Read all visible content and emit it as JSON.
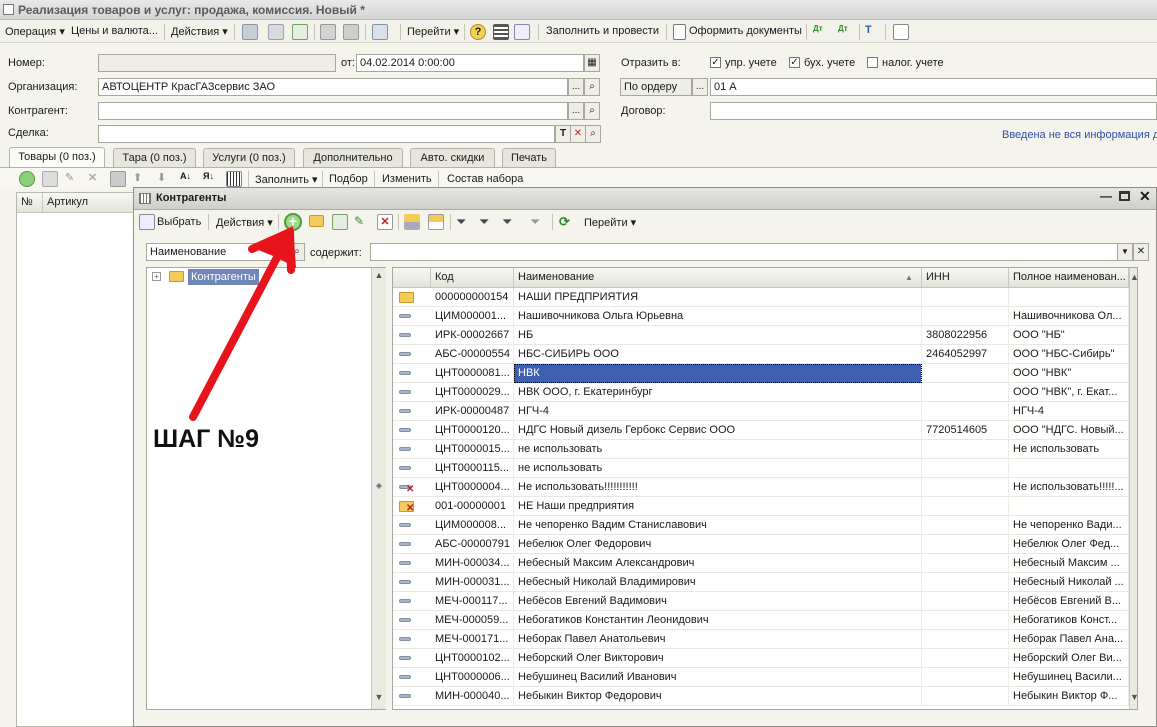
{
  "window": {
    "title": "Реализация товаров и услуг: продажа, комиссия. Новый *"
  },
  "menu": {
    "operation": "Операция ▾",
    "prices": "Цены и валюта...",
    "actions": "Действия ▾",
    "goto": "Перейти ▾",
    "fill_and_post": "Заполнить и провести",
    "make_docs": "Оформить документы"
  },
  "form": {
    "number_label": "Номер:",
    "number_value": "",
    "date_label": "от:",
    "date_value": "04.02.2014  0:00:00",
    "org_label": "Организация:",
    "org_value": "АВТОЦЕНТР КрасГАЗсервис ЗАО",
    "contractor_label": "Контрагент:",
    "contractor_value": "",
    "deal_label": "Сделка:",
    "deal_value": "",
    "reflect_label": "Отразить в:",
    "chk_mgmt": "упр. учете",
    "chk_acc": "бух. учете",
    "chk_tax": "налог. учете",
    "by_order": "По ордеру",
    "order_value": "01 А",
    "contract_label": "Договор:",
    "contract_value": "",
    "warning": "Введена не вся информация д"
  },
  "tabs": [
    "Товары (0 поз.)",
    "Тара (0 поз.)",
    "Услуги (0 поз.)",
    "Дополнительно",
    "Авто. скидки",
    "Печать"
  ],
  "items_toolbar": {
    "fill": "Заполнить ▾",
    "select": "Подбор",
    "change": "Изменить",
    "kit": "Состав набора"
  },
  "items_table": {
    "col_num": "№",
    "col_article": "Артикул"
  },
  "dialog": {
    "title": "Контрагенты",
    "select_btn": "Выбрать",
    "actions_btn": "Действия ▾",
    "goto_btn": "Перейти ▾",
    "search_field": "Наименование",
    "contains_label": "содержит:",
    "search_value": "",
    "tree_root": "Контрагенты",
    "columns": [
      "Код",
      "Наименование",
      "ИНН",
      "Полное наименован..."
    ],
    "rows": [
      {
        "icon": "folder",
        "code": "000000000154",
        "name": "НАШИ ПРЕДПРИЯТИЯ",
        "inn": "",
        "full": ""
      },
      {
        "icon": "item",
        "code": "ЦИМ000001...",
        "name": "Нашивочникова Ольга Юрьевна",
        "inn": "",
        "full": "Нашивочникова Ол..."
      },
      {
        "icon": "item",
        "code": "ИРК-00002667",
        "name": "НБ",
        "inn": "3808022956",
        "full": "ООО \"НБ\""
      },
      {
        "icon": "item",
        "code": "АБС-00000554",
        "name": "НБС-СИБИРЬ ООО",
        "inn": "2464052997",
        "full": "ООО \"НБС-Сибирь\""
      },
      {
        "icon": "item",
        "code": "ЦНТ0000081...",
        "name": "НВК",
        "inn": "",
        "full": "ООО \"НВК\""
      },
      {
        "icon": "item",
        "code": "ЦНТ0000029...",
        "name": "НВК ООО, г. Екатеринбург",
        "inn": "",
        "full": "ООО \"НВК\", г. Екат..."
      },
      {
        "icon": "item",
        "code": "ИРК-00000487",
        "name": "НГЧ-4",
        "inn": "",
        "full": "НГЧ-4"
      },
      {
        "icon": "item",
        "code": "ЦНТ0000120...",
        "name": "НДГС Новый дизель Гербокс Сервис ООО",
        "inn": "7720514605",
        "full": "ООО \"НДГС. Новый..."
      },
      {
        "icon": "item",
        "code": "ЦНТ0000015...",
        "name": "не использовать",
        "inn": "",
        "full": "Не использовать"
      },
      {
        "icon": "item",
        "code": "ЦНТ0000115...",
        "name": "не использовать",
        "inn": "",
        "full": ""
      },
      {
        "icon": "item-deleted",
        "code": "ЦНТ0000004...",
        "name": "Не использовать!!!!!!!!!!!",
        "inn": "",
        "full": "Не использовать!!!!!..."
      },
      {
        "icon": "folder-deleted",
        "code": "001-00000001",
        "name": "НЕ Наши предприятия",
        "inn": "",
        "full": ""
      },
      {
        "icon": "item",
        "code": "ЦИМ000008...",
        "name": "Не чепоренко Вадим Станиславович",
        "inn": "",
        "full": "Не чепоренко Вади..."
      },
      {
        "icon": "item",
        "code": "АБС-00000791",
        "name": "Небелюк Олег Федорович",
        "inn": "",
        "full": "Небелюк Олег Фед..."
      },
      {
        "icon": "item",
        "code": "МИН-000034...",
        "name": "Небесный Максим Александрович",
        "inn": "",
        "full": "Небесный Максим ..."
      },
      {
        "icon": "item",
        "code": "МИН-000031...",
        "name": "Небесный Николай Владимирович",
        "inn": "",
        "full": "Небесный Николай ..."
      },
      {
        "icon": "item",
        "code": "МЕЧ-000117...",
        "name": "Небёсов Евгений Вадимович",
        "inn": "",
        "full": "Небёсов Евгений В..."
      },
      {
        "icon": "item",
        "code": "МЕЧ-000059...",
        "name": "Небогатиков Константин Леонидович",
        "inn": "",
        "full": "Небогатиков Конст..."
      },
      {
        "icon": "item",
        "code": "МЕЧ-000171...",
        "name": "Неборак Павел Анатольевич",
        "inn": "",
        "full": "Неборак Павел Ана..."
      },
      {
        "icon": "item",
        "code": "ЦНТ0000102...",
        "name": "Неборский Олег Викторович",
        "inn": "",
        "full": "Неборский Олег Ви..."
      },
      {
        "icon": "item",
        "code": "ЦНТ0000006...",
        "name": "Небушинец Василий Иванович",
        "inn": "",
        "full": "Небушинец Васили..."
      },
      {
        "icon": "item",
        "code": "МИН-000040...",
        "name": "Небыкин Виктор Федорович",
        "inn": "",
        "full": "Небыкин Виктор Ф..."
      }
    ]
  },
  "annotation": {
    "step_text": "ШАГ №9",
    "arrow_color": "#e8141b"
  }
}
